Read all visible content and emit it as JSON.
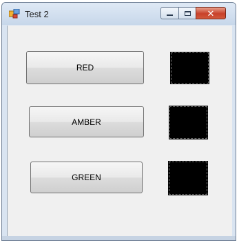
{
  "window": {
    "title": "Test 2",
    "icon": "window-app-icon",
    "controls": {
      "minimize": "minimize-icon",
      "maximize": "maximize-icon",
      "close_glyph": "✕"
    }
  },
  "buttons": {
    "red": "RED",
    "amber": "AMBER",
    "green": "GREEN"
  },
  "lamps": {
    "red": "#000000",
    "amber": "#000000",
    "green": "#000000"
  },
  "colors": {
    "client_background": "#f0f0f0",
    "close_button": "#c8412a",
    "title_bar": "#c7d7ea"
  }
}
